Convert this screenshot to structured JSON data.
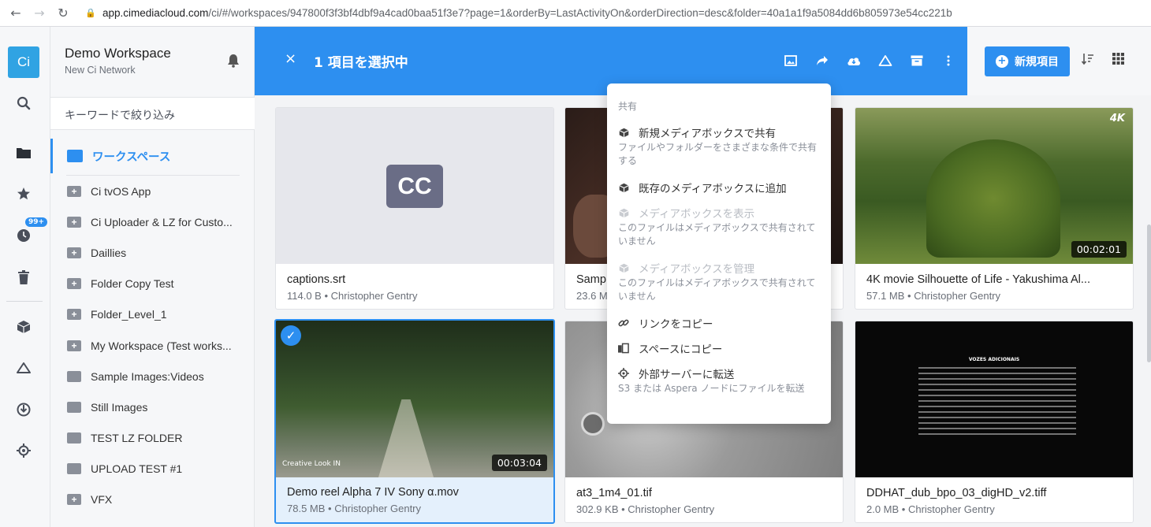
{
  "browser": {
    "url_host": "app.cimediacloud.com",
    "url_rest": "/ci/#/workspaces/947800f3f3bf4dbf9a4cad0baa51f3e7?page=1&orderBy=LastActivityOn&orderDirection=desc&folder=40a1a1f9a5084dd6b805973e54cc221b"
  },
  "rail": {
    "logo": "Ci",
    "badge": "99+"
  },
  "sidebar": {
    "workspace_title": "Demo Workspace",
    "workspace_subtitle": "New Ci Network",
    "filter_placeholder": "キーワードで絞り込み",
    "workspace_nav_label": "ワークスペース",
    "folders": [
      {
        "name": "Ci tvOS App",
        "plus": true
      },
      {
        "name": "Ci Uploader & LZ for Custo...",
        "plus": true
      },
      {
        "name": "Daillies",
        "plus": true
      },
      {
        "name": "Folder Copy Test",
        "plus": true
      },
      {
        "name": "Folder_Level_1",
        "plus": true
      },
      {
        "name": "My Workspace (Test works...",
        "plus": true
      },
      {
        "name": "Sample Images:Videos",
        "plus": false
      },
      {
        "name": "Still Images",
        "plus": false
      },
      {
        "name": "TEST LZ FOLDER",
        "plus": false
      },
      {
        "name": "UPLOAD TEST #1",
        "plus": false
      },
      {
        "name": "VFX",
        "plus": true
      }
    ]
  },
  "selection": {
    "close": "×",
    "count_label": "1 項目を選択中"
  },
  "toolbar": {
    "new_item_label": "新規項目"
  },
  "cards": [
    {
      "name": "captions.srt",
      "meta": "114.0 B • Christopher Gentry",
      "thumb": "cc"
    },
    {
      "name": "Samp",
      "meta": "23.6 M",
      "thumb": "dark"
    },
    {
      "name": "4K movie Silhouette of Life - Yakushima Al...",
      "meta": "57.1 MB • Christopher Gentry",
      "thumb": "forest",
      "duration": "00:02:01",
      "corner_label": "4K"
    },
    {
      "name": "Demo reel Alpha 7 IV Sony α.mov",
      "meta": "78.5 MB • Christopher Gentry",
      "thumb": "path",
      "duration": "00:03:04",
      "selected": true,
      "thumb_caption": "Creative Look  IN"
    },
    {
      "name": "at3_1m4_01.tif",
      "meta": "302.9 KB • Christopher Gentry",
      "thumb": "gray"
    },
    {
      "name": "DDHAT_dub_bpo_03_digHD_v2.tiff",
      "meta": "2.0 MB • Christopher Gentry",
      "thumb": "credits",
      "credits_title": "VOZES ADICIONAIS"
    }
  ],
  "menu": {
    "section_label": "共有",
    "items": [
      {
        "label": "新規メディアボックスで共有",
        "desc": "ファイルやフォルダーをさまざまな条件で共有する",
        "icon": "cube-icon",
        "disabled": false
      },
      {
        "label": "既存のメディアボックスに追加",
        "desc": "",
        "icon": "cube-icon",
        "disabled": false
      },
      {
        "label": "メディアボックスを表示",
        "desc": "このファイルはメディアボックスで共有されていません",
        "icon": "cube-icon",
        "disabled": true
      },
      {
        "label": "メディアボックスを管理",
        "desc": "このファイルはメディアボックスで共有されていません",
        "icon": "cube-icon",
        "disabled": true
      },
      {
        "label": "リンクをコピー",
        "desc": "",
        "icon": "link-icon",
        "disabled": false
      },
      {
        "label": "スペースにコピー",
        "desc": "",
        "icon": "copy-space-icon",
        "disabled": false
      },
      {
        "label": "外部サーバーに転送",
        "desc": "S3 または Aspera ノードにファイルを転送",
        "icon": "transfer-icon",
        "disabled": false
      }
    ]
  },
  "colors": {
    "accent": "#2d8ff0",
    "logo": "#30a3e3"
  }
}
